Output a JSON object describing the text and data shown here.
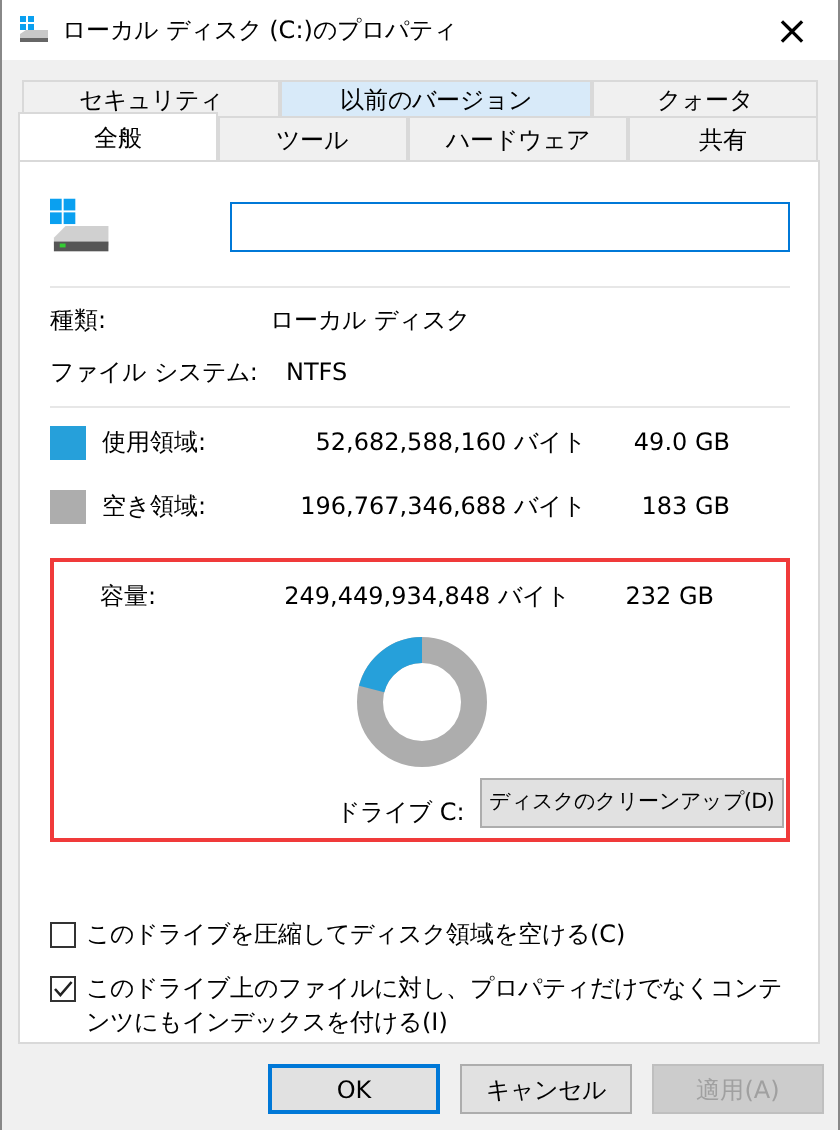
{
  "window": {
    "title": "ローカル ディスク (C:)のプロパティ",
    "close": "×"
  },
  "tab_rows": [
    [
      {
        "label": "セキュリティ",
        "selected": false,
        "hovered": false
      },
      {
        "label": "以前のバージョン",
        "selected": false,
        "hovered": true
      },
      {
        "label": "クォータ",
        "selected": false,
        "hovered": false
      }
    ],
    [
      {
        "label": "全般",
        "selected": true,
        "hovered": false
      },
      {
        "label": "ツール",
        "selected": false,
        "hovered": false
      },
      {
        "label": "ハードウェア",
        "selected": false,
        "hovered": false
      },
      {
        "label": "共有",
        "selected": false,
        "hovered": false
      }
    ]
  ],
  "info": [
    {
      "label": "種類:",
      "value": "ローカル ディスク"
    },
    {
      "label": "ファイル システム:",
      "value": "NTFS"
    }
  ],
  "space": [
    {
      "label": "使用領域:",
      "bytes": "52,682,588,160 バイト",
      "size": "49.0 GB",
      "color": "#26a0da"
    },
    {
      "label": "空き領域:",
      "bytes": "196,767,346,688 バイト",
      "size": "183 GB",
      "color": "#adadad"
    }
  ],
  "capacity": {
    "label": "容量:",
    "bytes": "249,449,934,848 バイト",
    "size": "232 GB"
  },
  "usage": {
    "level": 0.21
  },
  "drive_label": "ドライブ C:",
  "cleanup_button": "ディスクのクリーンアップ(D)",
  "options": [
    {
      "label": "このドライブを圧縮してディスク領域を空ける(C)",
      "checked": false
    },
    {
      "label": "このドライブ上のファイルに対し、プロパティだけでなくコンテンツにもインデックスを付ける(I)",
      "checked": true
    }
  ],
  "buttons": [
    {
      "label": "OK",
      "default": true,
      "disabled": false
    },
    {
      "label": "キャンセル",
      "default": false,
      "disabled": false
    },
    {
      "label": "適用(A)",
      "default": false,
      "disabled": true
    }
  ]
}
